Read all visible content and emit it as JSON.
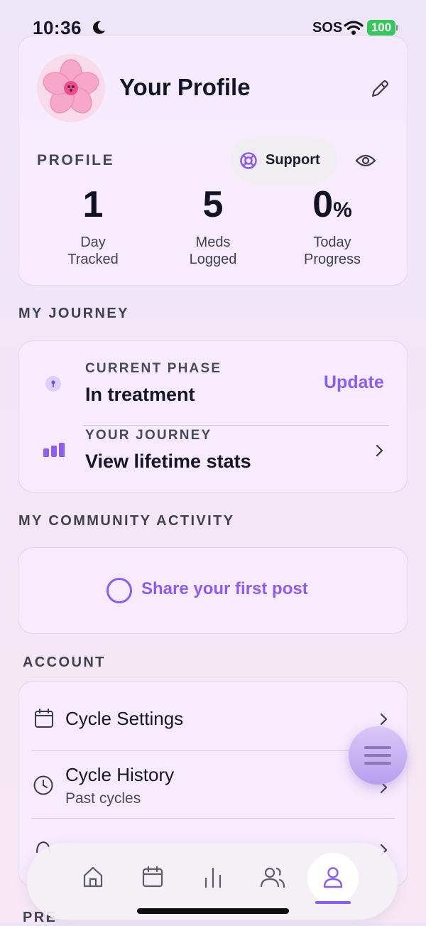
{
  "status_bar": {
    "time": "10:36",
    "sos": "SOS",
    "battery": "100"
  },
  "profile": {
    "title": "Your Profile",
    "section_label": "PROFILE",
    "support_label": "Support",
    "stats": [
      {
        "value": "1",
        "label_line1": "Day",
        "label_line2": "Tracked"
      },
      {
        "value": "5",
        "label_line1": "Meds",
        "label_line2": "Logged"
      },
      {
        "value": "0",
        "unit": "%",
        "label_line1": "Today",
        "label_line2": "Progress"
      }
    ]
  },
  "journey": {
    "section_label": "MY JOURNEY",
    "phase_kicker": "CURRENT PHASE",
    "phase_value": "In treatment",
    "update_label": "Update",
    "stats_kicker": "YOUR JOURNEY",
    "stats_title": "View lifetime stats"
  },
  "community": {
    "section_label": "MY COMMUNITY ACTIVITY",
    "share_label": "Share your first post"
  },
  "account": {
    "section_label": "ACCOUNT",
    "items": [
      {
        "title": "Cycle Settings"
      },
      {
        "title": "Cycle History",
        "subtitle": "Past cycles"
      }
    ]
  },
  "next_section_peek": "PRE",
  "tabs": [
    "home",
    "calendar",
    "stats",
    "community",
    "profile"
  ],
  "colors": {
    "accent": "#8b5cf6",
    "battery": "#35c759"
  }
}
